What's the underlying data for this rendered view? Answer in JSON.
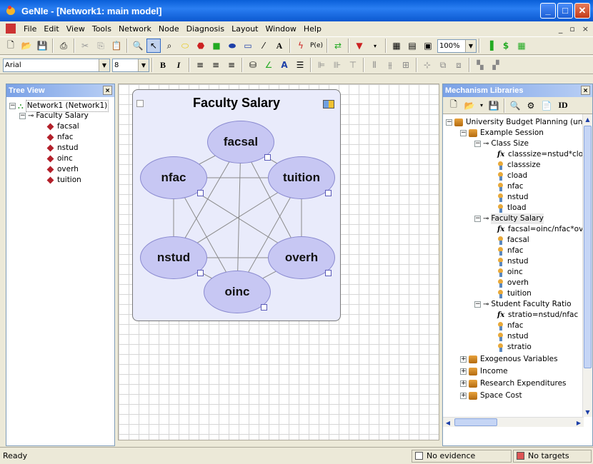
{
  "window": {
    "title": "GeNIe - [Network1: main model]"
  },
  "menu": [
    "File",
    "Edit",
    "View",
    "Tools",
    "Network",
    "Node",
    "Diagnosis",
    "Layout",
    "Window",
    "Help"
  ],
  "toolbar": {
    "zoom": "100%",
    "font": "Arial",
    "font_size": "8"
  },
  "tree_view": {
    "title": "Tree View",
    "network": "Network1 (Network1)",
    "submodel": "Faculty Salary",
    "nodes": [
      "facsal",
      "nfac",
      "nstud",
      "oinc",
      "overh",
      "tuition"
    ]
  },
  "canvas": {
    "submodel_title": "Faculty Salary",
    "nodes": [
      "facsal",
      "nfac",
      "tuition",
      "nstud",
      "overh",
      "oinc"
    ]
  },
  "mechanism": {
    "title": "Mechanism Libraries",
    "toolbar_id": "ID",
    "root": "University Budget Planning (univ",
    "session": "Example Session",
    "groups": [
      {
        "name": "Class Size",
        "formula": "classsize=nstud*cloa",
        "items": [
          "classsize",
          "cload",
          "nfac",
          "nstud",
          "tload"
        ]
      },
      {
        "name": "Faculty Salary",
        "formula": "facsal=oinc/nfac*ov",
        "items": [
          "facsal",
          "nfac",
          "nstud",
          "oinc",
          "overh",
          "tuition"
        ]
      },
      {
        "name": "Student Faculty Ratio",
        "formula": "stratio=nstud/nfac",
        "items": [
          "nfac",
          "nstud",
          "stratio"
        ]
      }
    ],
    "collapsed": [
      "Exogenous Variables",
      "Income",
      "Research Expenditures",
      "Space Cost"
    ]
  },
  "status": {
    "ready": "Ready",
    "evidence": "No evidence",
    "targets": "No targets"
  }
}
